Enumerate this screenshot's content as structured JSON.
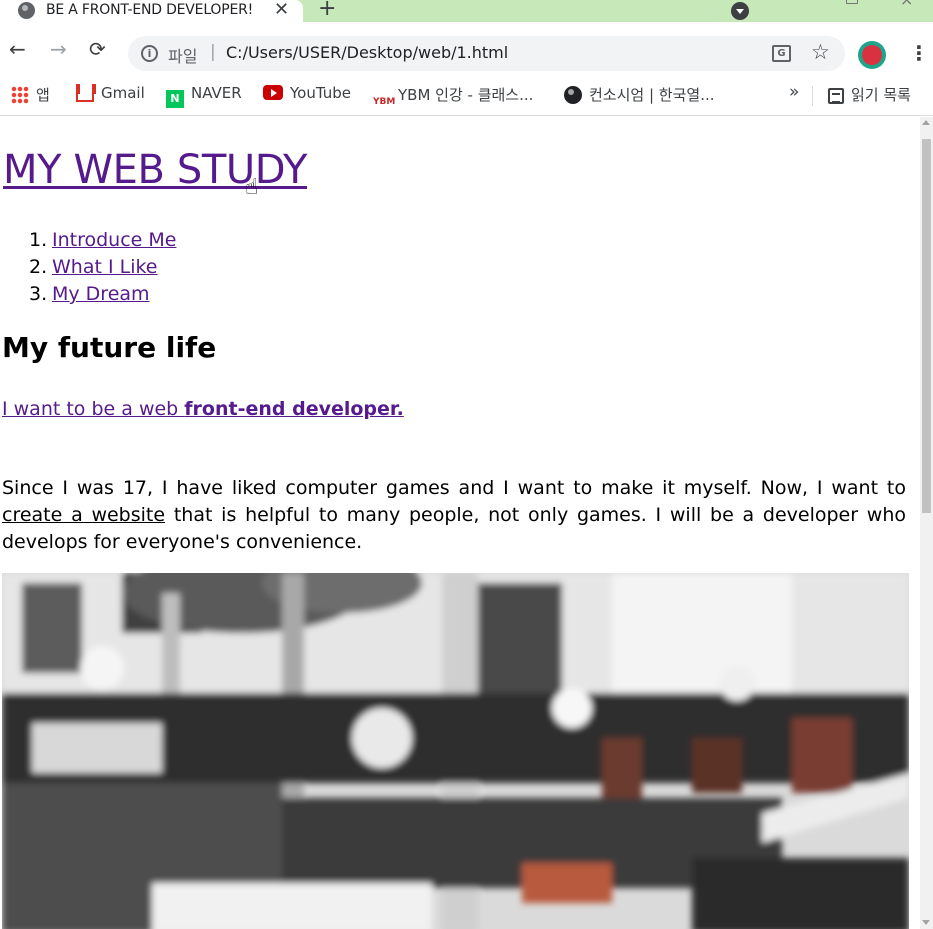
{
  "browser": {
    "tab": {
      "title": "BE A FRONT-END DEVELOPER!",
      "close_label": "✕",
      "favicon": "globe-icon"
    },
    "new_tab_label": "+",
    "nav": {
      "back": "←",
      "forward": "→",
      "reload": "⟳"
    },
    "omnibox": {
      "info_icon": "i",
      "scheme_label": "파일",
      "separator": "|",
      "url": "C:/Users/USER/Desktop/web/1.html"
    },
    "translate_icon_label": "G",
    "star_icon": "☆",
    "menu_icon": "⋮",
    "bookmarks": [
      {
        "label": "앱",
        "icon": "apps-grid-icon"
      },
      {
        "label": "Gmail",
        "icon": "gmail-icon"
      },
      {
        "label": "NAVER",
        "icon": "naver-icon"
      },
      {
        "label": "YouTube",
        "icon": "youtube-icon"
      },
      {
        "label": "YBM 인강 - 클래스...",
        "icon": "ybm-icon"
      },
      {
        "label": "컨소시엄 | 한국열...",
        "icon": "globe-icon"
      }
    ],
    "bookmarks_more": "»",
    "reading_list_label": "읽기 목록",
    "naver_icon_letter": "N",
    "ybm_icon_text": "YBM"
  },
  "page": {
    "title": "MY WEB STUDY",
    "toc": [
      {
        "number": "1.",
        "label": "Introduce Me"
      },
      {
        "number": "2.",
        "label": "What I Like"
      },
      {
        "number": "3.",
        "label": "My Dream"
      }
    ],
    "section_heading": "My future life",
    "intro_link": {
      "prefix": "I want to be a web ",
      "bold": "front-end developer."
    },
    "paragraph": {
      "before": "Since I was 17, I have liked computer games and I want to make it myself. Now, I want to ",
      "link": "create a website",
      "after": " that is helpful to many people, not only games. I will be a developer who develops for everyone's convenience."
    },
    "cursor": "☝"
  }
}
